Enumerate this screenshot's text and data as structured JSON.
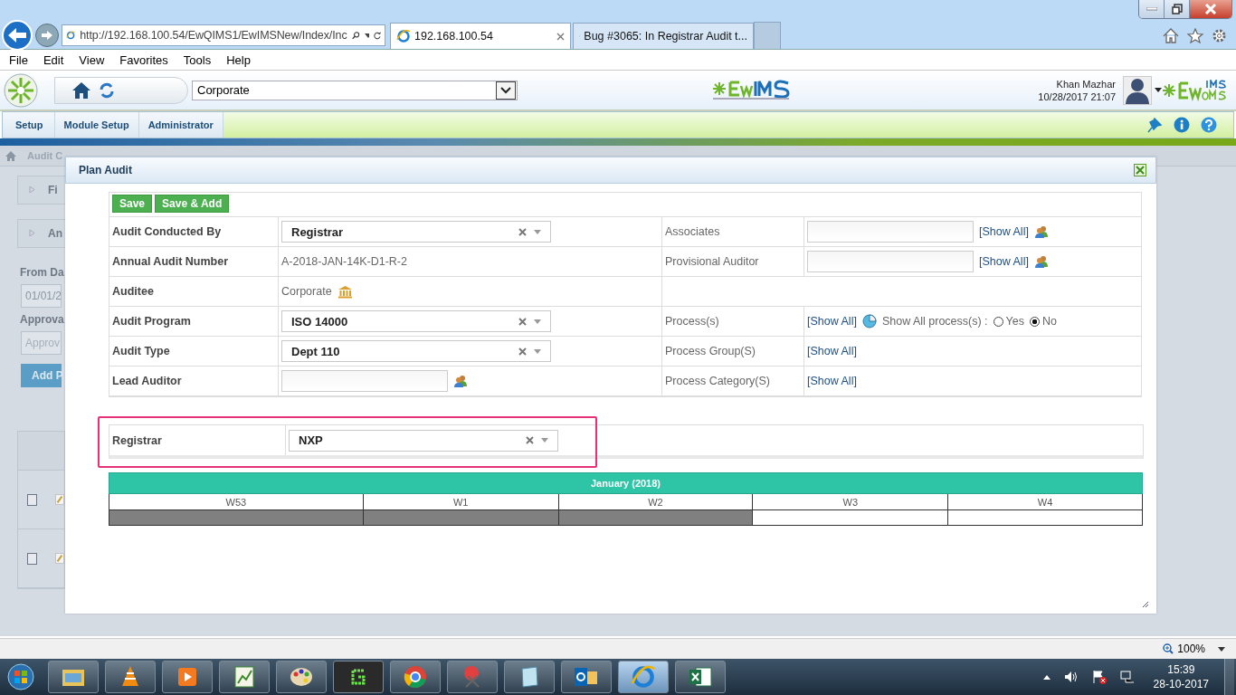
{
  "browser": {
    "address": "http://192.168.100.54/EwQIMS1/EwIMSNew/Index/Inc",
    "tabs": [
      {
        "title": "192.168.100.54",
        "selected": true
      },
      {
        "title": "Bug #3065: In Registrar Audit t...",
        "selected": false
      }
    ],
    "menu": [
      "File",
      "Edit",
      "View",
      "Favorites",
      "Tools",
      "Help"
    ]
  },
  "app": {
    "org": "Corporate",
    "user_name": "Khan Mazhar",
    "datetime": "10/28/2017 21:07",
    "nav": [
      "Setup",
      "Module Setup",
      "Administrator"
    ]
  },
  "background": {
    "breadcrumb": "Audit C",
    "panels": [
      "Fi",
      "An"
    ],
    "from_label": "From Da",
    "from_value": "01/01/2",
    "approval_label": "Approva",
    "approval_placeholder": "Approv",
    "add_button": "Add P",
    "rows": [
      {
        "checked": false
      },
      {
        "checked": false
      }
    ]
  },
  "modal": {
    "title": "Plan Audit",
    "buttons": [
      "Save",
      "Save & Add"
    ],
    "left_rows": [
      {
        "label": "Audit Conducted By",
        "kind": "select",
        "value": "Registrar"
      },
      {
        "label": "Annual Audit Number",
        "kind": "text",
        "value": "A-2018-JAN-14K-D1-R-2"
      },
      {
        "label": "Auditee",
        "kind": "auditee",
        "value": "Corporate"
      },
      {
        "label": "Audit Program",
        "kind": "select",
        "value": "ISO 14000"
      },
      {
        "label": "Audit Type",
        "kind": "select",
        "value": "Dept 110"
      },
      {
        "label": "Lead Auditor",
        "kind": "lookup"
      }
    ],
    "right_rows": [
      {
        "label": "Associates",
        "kind": "lookup",
        "link": "[Show All]"
      },
      {
        "label": "Provisional Auditor",
        "kind": "lookup",
        "link": "[Show All]"
      },
      {
        "kind": "empty"
      },
      {
        "label": "Process(s)",
        "kind": "process",
        "link": "[Show All]",
        "note": "Show All process(s) :",
        "options": [
          {
            "label": "Yes",
            "selected": false
          },
          {
            "label": "No",
            "selected": true
          }
        ]
      },
      {
        "label": "Process Group(S)",
        "kind": "link",
        "link": "[Show All]"
      },
      {
        "label": "Process Category(S)",
        "kind": "link",
        "link": "[Show All]"
      }
    ],
    "registrar": {
      "label": "Registrar",
      "value": "NXP"
    },
    "calendar": {
      "month": "January (2018)",
      "weeks": [
        {
          "label": "W53",
          "filled": true
        },
        {
          "label": "W1",
          "filled": true
        },
        {
          "label": "W2",
          "filled": true
        },
        {
          "label": "W3",
          "filled": false
        },
        {
          "label": "W4",
          "filled": false
        }
      ]
    }
  },
  "status": {
    "zoom": "100%"
  },
  "taskbar": {
    "time": "15:39",
    "date": "28-10-2017"
  }
}
